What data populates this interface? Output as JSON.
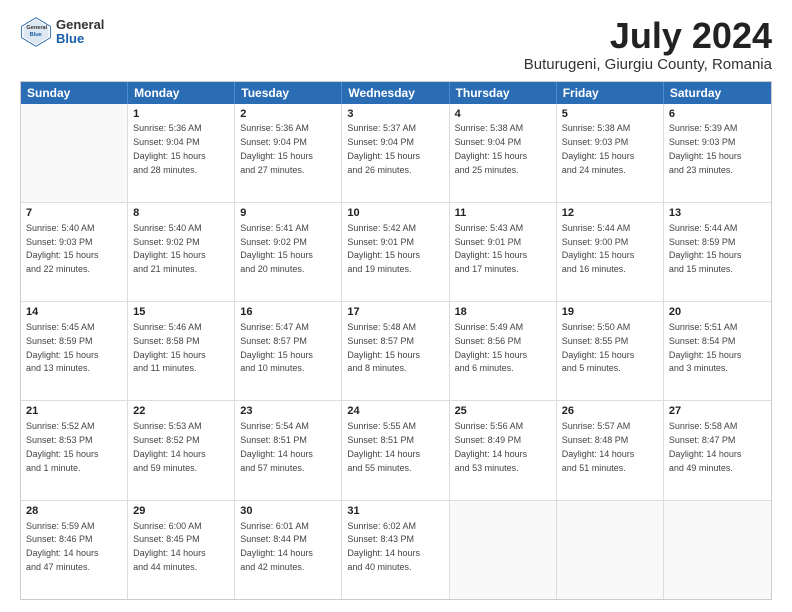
{
  "header": {
    "logo": {
      "general": "General",
      "blue": "Blue"
    },
    "title": "July 2024",
    "location": "Buturugeni, Giurgiu County, Romania"
  },
  "calendar": {
    "days": [
      "Sunday",
      "Monday",
      "Tuesday",
      "Wednesday",
      "Thursday",
      "Friday",
      "Saturday"
    ],
    "rows": [
      [
        {
          "day": "",
          "content": ""
        },
        {
          "day": "1",
          "content": "Sunrise: 5:36 AM\nSunset: 9:04 PM\nDaylight: 15 hours\nand 28 minutes."
        },
        {
          "day": "2",
          "content": "Sunrise: 5:36 AM\nSunset: 9:04 PM\nDaylight: 15 hours\nand 27 minutes."
        },
        {
          "day": "3",
          "content": "Sunrise: 5:37 AM\nSunset: 9:04 PM\nDaylight: 15 hours\nand 26 minutes."
        },
        {
          "day": "4",
          "content": "Sunrise: 5:38 AM\nSunset: 9:04 PM\nDaylight: 15 hours\nand 25 minutes."
        },
        {
          "day": "5",
          "content": "Sunrise: 5:38 AM\nSunset: 9:03 PM\nDaylight: 15 hours\nand 24 minutes."
        },
        {
          "day": "6",
          "content": "Sunrise: 5:39 AM\nSunset: 9:03 PM\nDaylight: 15 hours\nand 23 minutes."
        }
      ],
      [
        {
          "day": "7",
          "content": "Sunrise: 5:40 AM\nSunset: 9:03 PM\nDaylight: 15 hours\nand 22 minutes."
        },
        {
          "day": "8",
          "content": "Sunrise: 5:40 AM\nSunset: 9:02 PM\nDaylight: 15 hours\nand 21 minutes."
        },
        {
          "day": "9",
          "content": "Sunrise: 5:41 AM\nSunset: 9:02 PM\nDaylight: 15 hours\nand 20 minutes."
        },
        {
          "day": "10",
          "content": "Sunrise: 5:42 AM\nSunset: 9:01 PM\nDaylight: 15 hours\nand 19 minutes."
        },
        {
          "day": "11",
          "content": "Sunrise: 5:43 AM\nSunset: 9:01 PM\nDaylight: 15 hours\nand 17 minutes."
        },
        {
          "day": "12",
          "content": "Sunrise: 5:44 AM\nSunset: 9:00 PM\nDaylight: 15 hours\nand 16 minutes."
        },
        {
          "day": "13",
          "content": "Sunrise: 5:44 AM\nSunset: 8:59 PM\nDaylight: 15 hours\nand 15 minutes."
        }
      ],
      [
        {
          "day": "14",
          "content": "Sunrise: 5:45 AM\nSunset: 8:59 PM\nDaylight: 15 hours\nand 13 minutes."
        },
        {
          "day": "15",
          "content": "Sunrise: 5:46 AM\nSunset: 8:58 PM\nDaylight: 15 hours\nand 11 minutes."
        },
        {
          "day": "16",
          "content": "Sunrise: 5:47 AM\nSunset: 8:57 PM\nDaylight: 15 hours\nand 10 minutes."
        },
        {
          "day": "17",
          "content": "Sunrise: 5:48 AM\nSunset: 8:57 PM\nDaylight: 15 hours\nand 8 minutes."
        },
        {
          "day": "18",
          "content": "Sunrise: 5:49 AM\nSunset: 8:56 PM\nDaylight: 15 hours\nand 6 minutes."
        },
        {
          "day": "19",
          "content": "Sunrise: 5:50 AM\nSunset: 8:55 PM\nDaylight: 15 hours\nand 5 minutes."
        },
        {
          "day": "20",
          "content": "Sunrise: 5:51 AM\nSunset: 8:54 PM\nDaylight: 15 hours\nand 3 minutes."
        }
      ],
      [
        {
          "day": "21",
          "content": "Sunrise: 5:52 AM\nSunset: 8:53 PM\nDaylight: 15 hours\nand 1 minute."
        },
        {
          "day": "22",
          "content": "Sunrise: 5:53 AM\nSunset: 8:52 PM\nDaylight: 14 hours\nand 59 minutes."
        },
        {
          "day": "23",
          "content": "Sunrise: 5:54 AM\nSunset: 8:51 PM\nDaylight: 14 hours\nand 57 minutes."
        },
        {
          "day": "24",
          "content": "Sunrise: 5:55 AM\nSunset: 8:51 PM\nDaylight: 14 hours\nand 55 minutes."
        },
        {
          "day": "25",
          "content": "Sunrise: 5:56 AM\nSunset: 8:49 PM\nDaylight: 14 hours\nand 53 minutes."
        },
        {
          "day": "26",
          "content": "Sunrise: 5:57 AM\nSunset: 8:48 PM\nDaylight: 14 hours\nand 51 minutes."
        },
        {
          "day": "27",
          "content": "Sunrise: 5:58 AM\nSunset: 8:47 PM\nDaylight: 14 hours\nand 49 minutes."
        }
      ],
      [
        {
          "day": "28",
          "content": "Sunrise: 5:59 AM\nSunset: 8:46 PM\nDaylight: 14 hours\nand 47 minutes."
        },
        {
          "day": "29",
          "content": "Sunrise: 6:00 AM\nSunset: 8:45 PM\nDaylight: 14 hours\nand 44 minutes."
        },
        {
          "day": "30",
          "content": "Sunrise: 6:01 AM\nSunset: 8:44 PM\nDaylight: 14 hours\nand 42 minutes."
        },
        {
          "day": "31",
          "content": "Sunrise: 6:02 AM\nSunset: 8:43 PM\nDaylight: 14 hours\nand 40 minutes."
        },
        {
          "day": "",
          "content": ""
        },
        {
          "day": "",
          "content": ""
        },
        {
          "day": "",
          "content": ""
        }
      ]
    ]
  }
}
